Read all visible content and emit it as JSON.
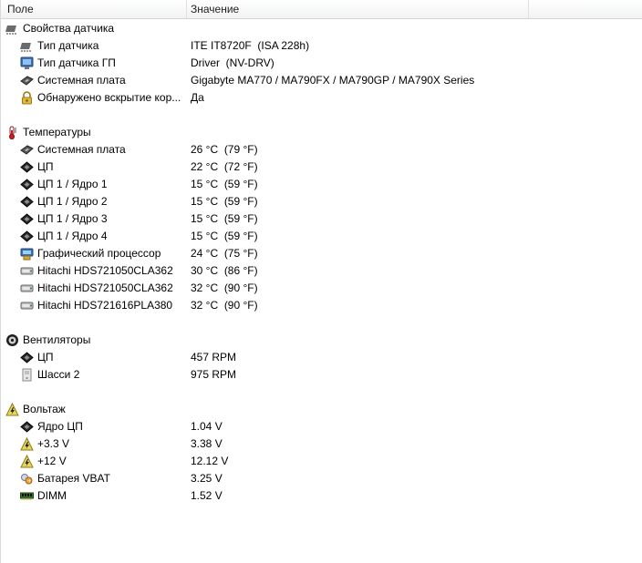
{
  "header": {
    "col_field": "Поле",
    "col_value": "Значение"
  },
  "groups": [
    {
      "label": "Свойства датчика",
      "icon": "sensor-props-icon",
      "items": [
        {
          "label": "Тип датчика",
          "value": "ITE IT8720F  (ISA 228h)",
          "icon": "chip-icon"
        },
        {
          "label": "Тип датчика ГП",
          "value": "Driver  (NV-DRV)",
          "icon": "monitor-icon"
        },
        {
          "label": "Системная плата",
          "value": "Gigabyte MA770 / MA790FX / MA790GP / MA790X Series",
          "icon": "motherboard-icon"
        },
        {
          "label": "Обнаружено вскрытие кор...",
          "value": "Да",
          "icon": "lock-icon"
        }
      ]
    },
    {
      "label": "Температуры",
      "icon": "thermometer-icon",
      "items": [
        {
          "label": "Системная плата",
          "value": "26 °C  (79 °F)",
          "icon": "motherboard-icon"
        },
        {
          "label": "ЦП",
          "value": "22 °C  (72 °F)",
          "icon": "cpu-icon"
        },
        {
          "label": "ЦП 1 / Ядро 1",
          "value": "15 °C  (59 °F)",
          "icon": "cpu-icon"
        },
        {
          "label": "ЦП 1 / Ядро 2",
          "value": "15 °C  (59 °F)",
          "icon": "cpu-icon"
        },
        {
          "label": "ЦП 1 / Ядро 3",
          "value": "15 °C  (59 °F)",
          "icon": "cpu-icon"
        },
        {
          "label": "ЦП 1 / Ядро 4",
          "value": "15 °C  (59 °F)",
          "icon": "cpu-icon"
        },
        {
          "label": "Графический процессор",
          "value": "24 °C  (75 °F)",
          "icon": "gpu-icon"
        },
        {
          "label": "Hitachi HDS721050CLA362",
          "value": "30 °C  (86 °F)",
          "icon": "hdd-icon"
        },
        {
          "label": "Hitachi HDS721050CLA362",
          "value": "32 °C  (90 °F)",
          "icon": "hdd-icon"
        },
        {
          "label": "Hitachi HDS721616PLA380",
          "value": "32 °C  (90 °F)",
          "icon": "hdd-icon"
        }
      ]
    },
    {
      "label": "Вентиляторы",
      "icon": "fan-icon",
      "items": [
        {
          "label": "ЦП",
          "value": "457 RPM",
          "icon": "cpu-icon"
        },
        {
          "label": "Шасси 2",
          "value": "975 RPM",
          "icon": "chassis-icon"
        }
      ]
    },
    {
      "label": "Вольтаж",
      "icon": "voltage-icon",
      "items": [
        {
          "label": "Ядро ЦП",
          "value": "1.04 V",
          "icon": "cpu-icon"
        },
        {
          "label": "+3.3 V",
          "value": "3.38 V",
          "icon": "voltage-icon"
        },
        {
          "label": "+12 V",
          "value": "12.12 V",
          "icon": "voltage-icon"
        },
        {
          "label": "Батарея VBAT",
          "value": "3.25 V",
          "icon": "battery-icon"
        },
        {
          "label": "DIMM",
          "value": "1.52 V",
          "icon": "dimm-icon"
        }
      ]
    }
  ]
}
